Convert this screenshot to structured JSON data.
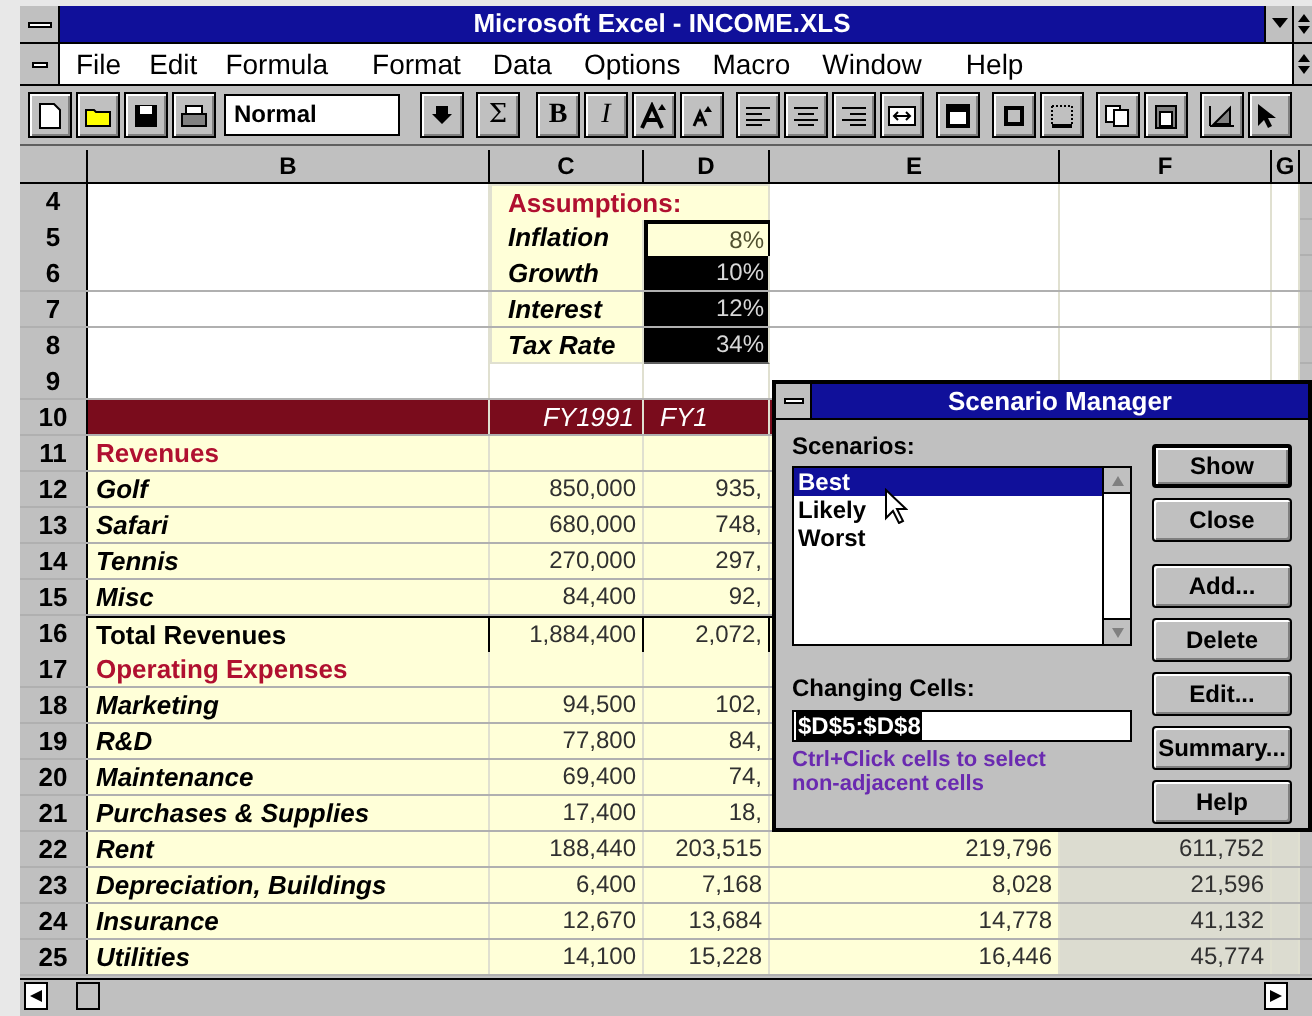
{
  "window": {
    "title": "Microsoft Excel - INCOME.XLS"
  },
  "menu": [
    "File",
    "Edit",
    "Formula",
    "Format",
    "Data",
    "Options",
    "Macro",
    "Window",
    "Help"
  ],
  "toolbar": {
    "style": "Normal",
    "glyphs": [
      "Σ",
      "B",
      "I"
    ]
  },
  "columns": [
    "B",
    "C",
    "D",
    "E",
    "F",
    "G"
  ],
  "rows": [
    {
      "number": "4",
      "kind": "assumptions-title",
      "c": "Assumptions:"
    },
    {
      "number": "5",
      "kind": "assumption",
      "c": "Inflation",
      "d": "8%",
      "selected": true,
      "active": true
    },
    {
      "number": "6",
      "kind": "assumption",
      "c": "Growth",
      "d": "10%",
      "selected": true,
      "active": false
    },
    {
      "number": "7",
      "kind": "assumption",
      "c": "Interest",
      "d": "12%",
      "selected": true,
      "active": false
    },
    {
      "number": "8",
      "kind": "assumption",
      "c": "Tax Rate",
      "d": "34%",
      "selected": true,
      "active": false
    },
    {
      "number": "9",
      "kind": "blank"
    },
    {
      "number": "10",
      "kind": "band",
      "c": "FY1991",
      "d": "FY1"
    },
    {
      "number": "11",
      "kind": "section",
      "b": "Revenues"
    },
    {
      "number": "12",
      "kind": "item",
      "b": "Golf",
      "c": "850,000",
      "d": "935,"
    },
    {
      "number": "13",
      "kind": "item",
      "b": "Safari",
      "c": "680,000",
      "d": "748,"
    },
    {
      "number": "14",
      "kind": "item",
      "b": "Tennis",
      "c": "270,000",
      "d": "297,"
    },
    {
      "number": "15",
      "kind": "item",
      "b": "Misc",
      "c": "84,400",
      "d": "92,"
    },
    {
      "number": "16",
      "kind": "total",
      "b": "Total Revenues",
      "c": "1,884,400",
      "d": "2,072,"
    },
    {
      "number": "17",
      "kind": "section",
      "b": "Operating Expenses"
    },
    {
      "number": "18",
      "kind": "item",
      "b": "Marketing",
      "c": "94,500",
      "d": "102,"
    },
    {
      "number": "19",
      "kind": "item",
      "b": "R&D",
      "c": "77,800",
      "d": "84,"
    },
    {
      "number": "20",
      "kind": "item",
      "b": "Maintenance",
      "c": "69,400",
      "d": "74,"
    },
    {
      "number": "21",
      "kind": "item",
      "b": "Purchases & Supplies",
      "c": "17,400",
      "d": "18,"
    },
    {
      "number": "22",
      "kind": "item",
      "b": "Rent",
      "c": "188,440",
      "d": "203,515",
      "e": "219,796",
      "f": "611,752"
    },
    {
      "number": "23",
      "kind": "item",
      "b": "Depreciation, Buildings",
      "c": "6,400",
      "d": "7,168",
      "e": "8,028",
      "f": "21,596"
    },
    {
      "number": "24",
      "kind": "item",
      "b": "Insurance",
      "c": "12,670",
      "d": "13,684",
      "e": "14,778",
      "f": "41,132"
    },
    {
      "number": "25",
      "kind": "item",
      "b": "Utilities",
      "c": "14,100",
      "d": "15,228",
      "e": "16,446",
      "f": "45,774"
    }
  ],
  "dialog": {
    "title": "Scenario Manager",
    "list_label": "Scenarios:",
    "scenarios": [
      {
        "label": "Best",
        "selected": true
      },
      {
        "label": "Likely",
        "selected": false
      },
      {
        "label": "Worst",
        "selected": false
      }
    ],
    "changing_label": "Changing Cells:",
    "changing_value": "$D$5:$D$8",
    "hint": "Ctrl+Click cells to select non-adjacent cells",
    "buttons": [
      {
        "label": "Show",
        "default": true
      },
      {
        "label": "Close",
        "default": false
      },
      {
        "label": "Add...",
        "default": false
      },
      {
        "label": "Delete",
        "default": false
      },
      {
        "label": "Edit...",
        "default": false
      },
      {
        "label": "Summary...",
        "default": false
      },
      {
        "label": "Help",
        "default": false
      }
    ]
  }
}
